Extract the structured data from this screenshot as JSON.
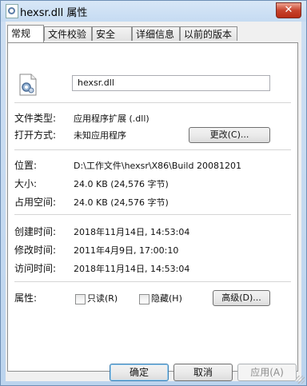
{
  "window": {
    "title": "hexsr.dll 属性",
    "close_label": "✕"
  },
  "tabs": [
    {
      "label": "常规",
      "active": true
    },
    {
      "label": "文件校验",
      "active": false
    },
    {
      "label": "安全",
      "active": false
    },
    {
      "label": "详细信息",
      "active": false
    },
    {
      "label": "以前的版本",
      "active": false
    }
  ],
  "general": {
    "file_name": "hexsr.dll",
    "file_type_label": "文件类型:",
    "file_type_value": "应用程序扩展 (.dll)",
    "open_with_label": "打开方式:",
    "open_with_value": "未知应用程序",
    "change_button": "更改(C)...",
    "location_label": "位置:",
    "location_value": "D:\\工作文件\\hexsr\\X86\\Build 20081201",
    "size_label": "大小:",
    "size_value": "24.0 KB (24,576 字节)",
    "size_on_disk_label": "占用空间:",
    "size_on_disk_value": "24.0 KB (24,576 字节)",
    "created_label": "创建时间:",
    "created_value": "2018年11月14日, 14:53:04",
    "modified_label": "修改时间:",
    "modified_value": "2011年4月9日, 17:00:10",
    "accessed_label": "访问时间:",
    "accessed_value": "2018年11月14日, 14:53:04",
    "attributes_label": "属性:",
    "readonly_label": "只读(R)",
    "readonly_checked": false,
    "hidden_label": "隐藏(H)",
    "hidden_checked": false,
    "advanced_button": "高级(D)..."
  },
  "footer": {
    "ok_label": "确定",
    "cancel_label": "取消",
    "apply_label": "应用(A)"
  }
}
